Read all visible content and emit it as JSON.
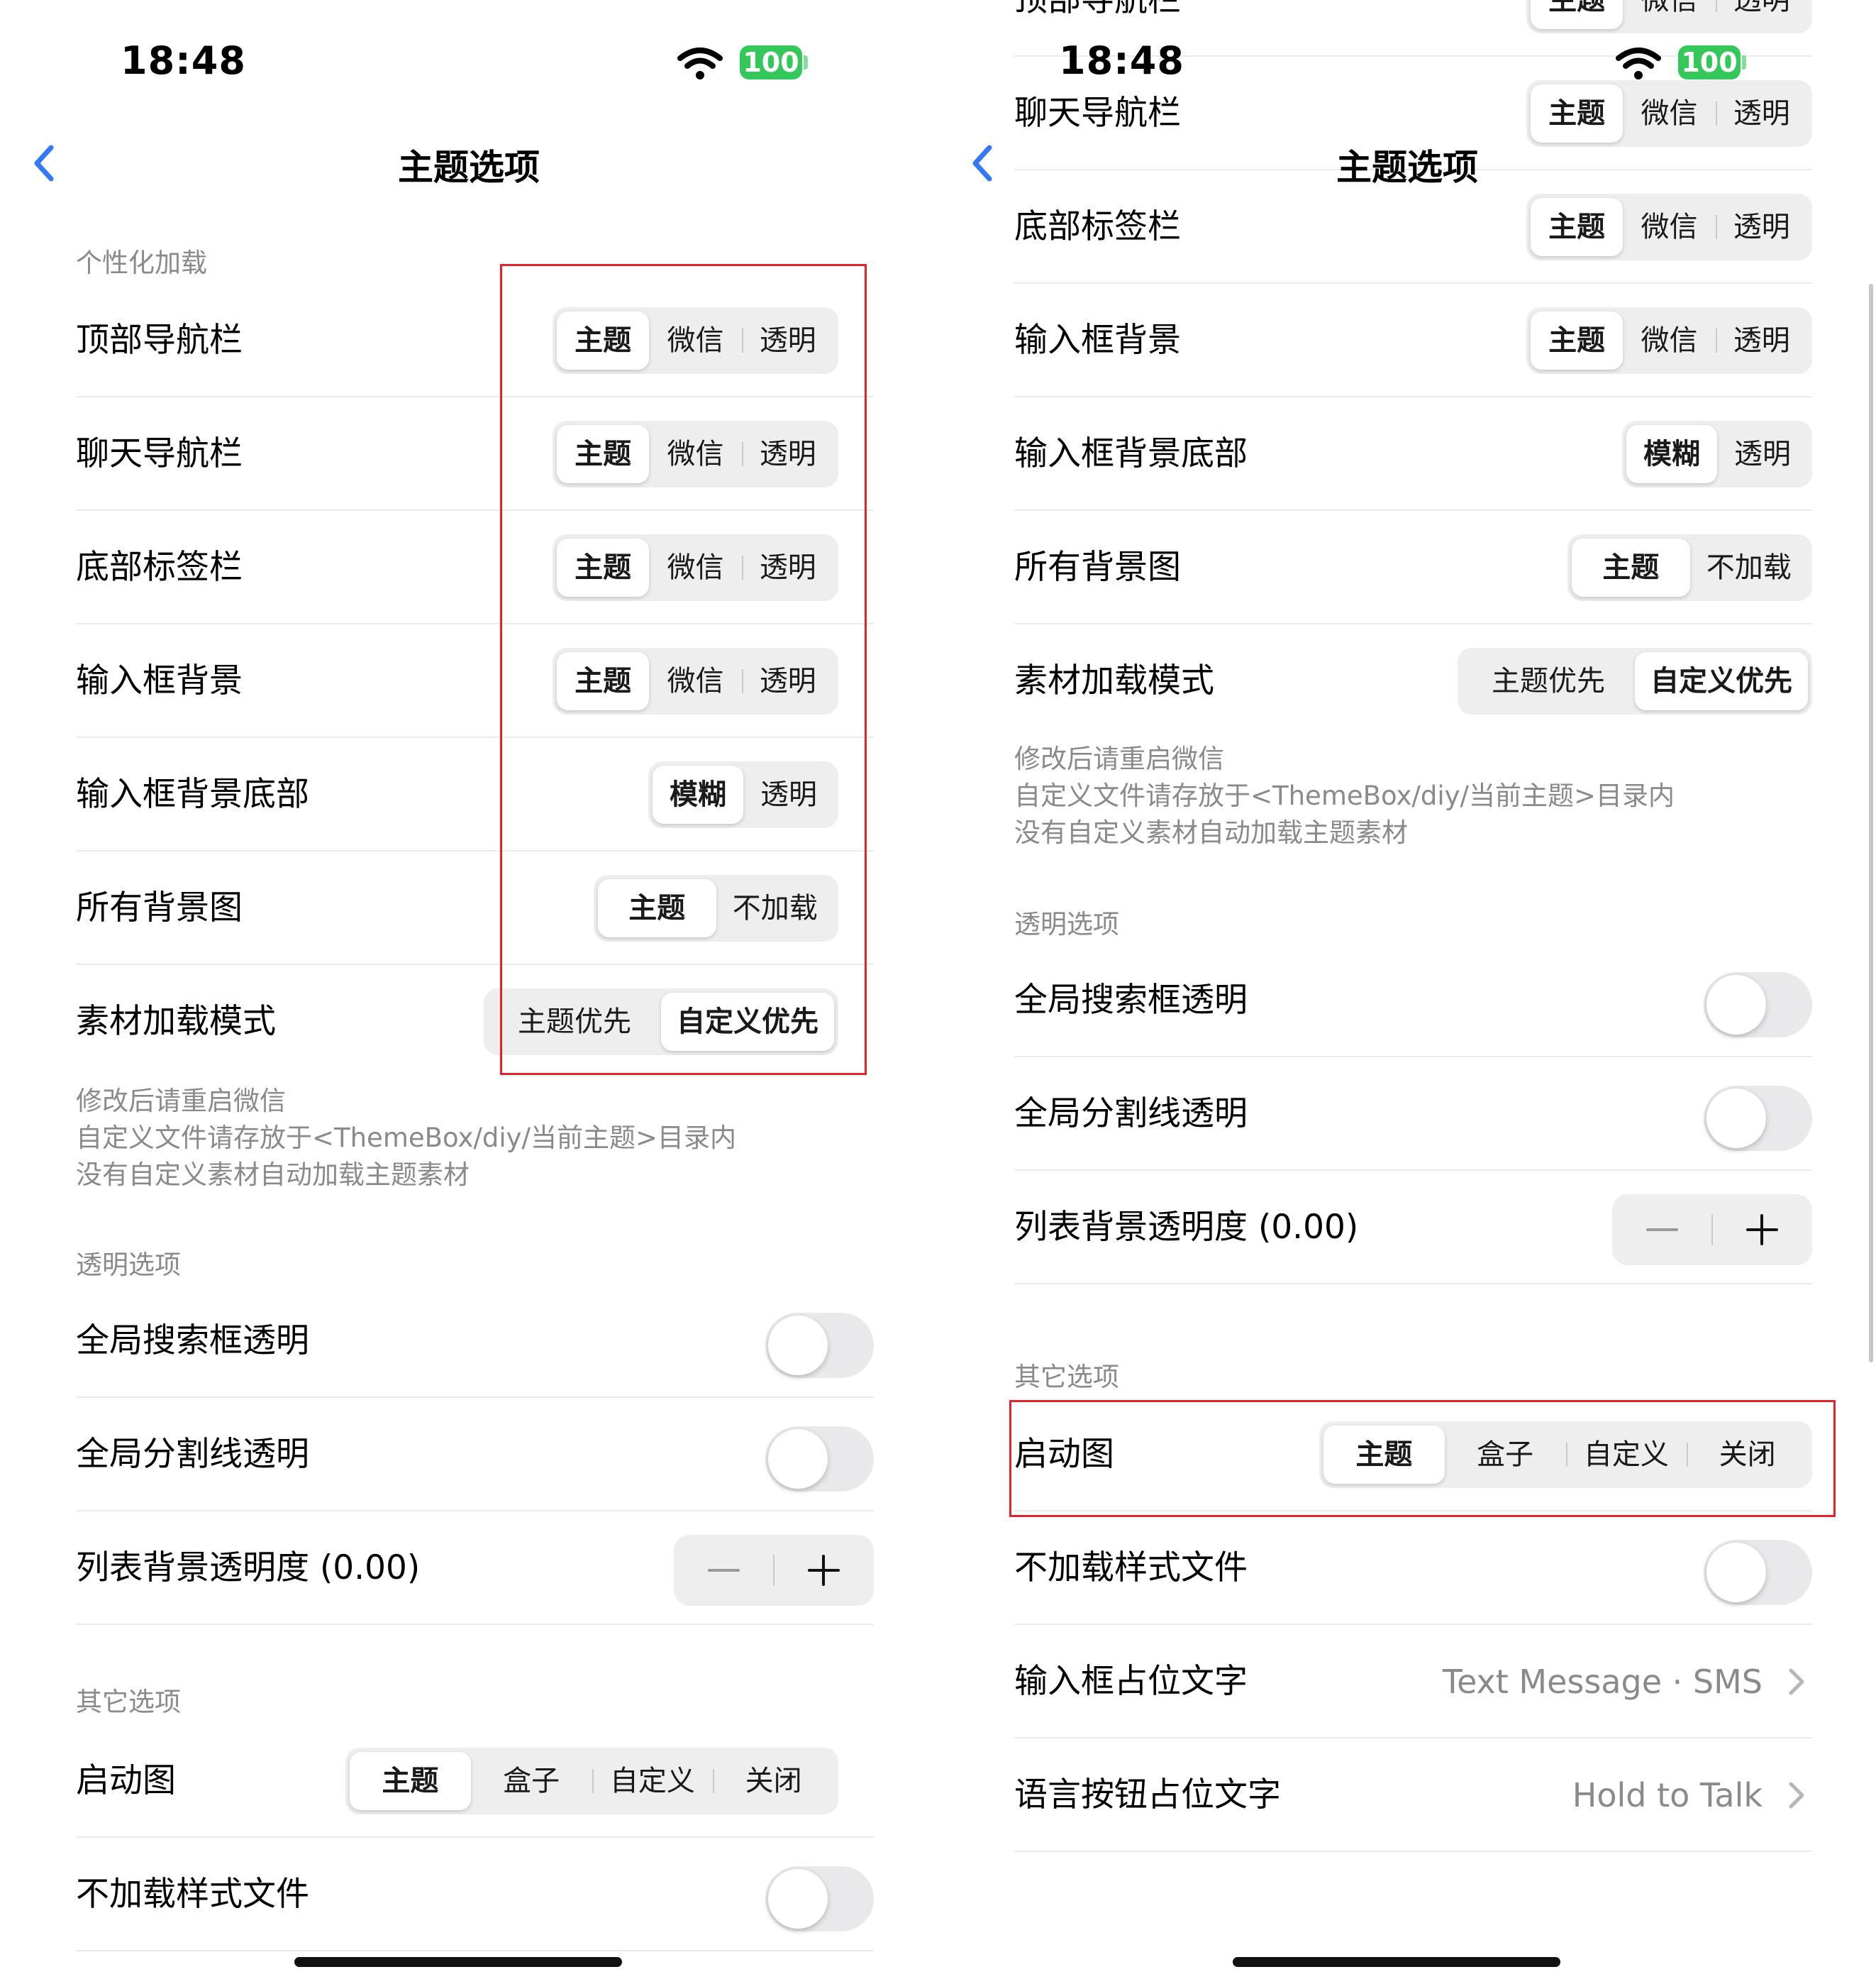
{
  "status": {
    "time": "18:48",
    "battery": "100"
  },
  "nav": {
    "title": "主题选项"
  },
  "sections": {
    "personalize": "个性化加载",
    "transparent": "透明选项",
    "other": "其它选项"
  },
  "rows": {
    "top_nav": {
      "label": "顶部导航栏",
      "options": [
        "主题",
        "微信",
        "透明"
      ]
    },
    "chat_nav": {
      "label": "聊天导航栏",
      "options": [
        "主题",
        "微信",
        "透明"
      ]
    },
    "bottom_tab": {
      "label": "底部标签栏",
      "options": [
        "主题",
        "微信",
        "透明"
      ]
    },
    "input_bg": {
      "label": "输入框背景",
      "options": [
        "主题",
        "微信",
        "透明"
      ]
    },
    "input_bg_bottom": {
      "label": "输入框背景底部",
      "options": [
        "模糊",
        "透明"
      ]
    },
    "all_bg": {
      "label": "所有背景图",
      "options": [
        "主题",
        "不加载"
      ]
    },
    "material_mode": {
      "label": "素材加载模式",
      "options": [
        "主题优先",
        "自定义优先"
      ]
    },
    "search_transparent": {
      "label": "全局搜索框透明"
    },
    "divider_transparent": {
      "label": "全局分割线透明"
    },
    "list_opacity": {
      "label": "列表背景透明度 (0.00)"
    },
    "launch_image": {
      "label": "启动图",
      "options": [
        "主题",
        "盒子",
        "自定义",
        "关闭"
      ]
    },
    "no_style": {
      "label": "不加载样式文件"
    },
    "input_placeholder": {
      "label": "输入框占位文字",
      "value": "Text Message · SMS"
    },
    "voice_placeholder": {
      "label": "语言按钮占位文字",
      "value": "Hold to Talk"
    }
  },
  "footnote": {
    "line1": "修改后请重启微信",
    "line2": "自定义文件请存放于<ThemeBox/diy/当前主题>目录内",
    "line3": "没有自定义素材自动加载主题素材"
  },
  "colors": {
    "accent": "#3478f6",
    "switch_off": "#e9e9eb",
    "battery": "#34c759",
    "highlight_box": "#e0242a"
  },
  "icons": [
    "wifi-icon",
    "back-chevron-icon",
    "minus-icon",
    "plus-icon",
    "chevron-right-icon"
  ]
}
